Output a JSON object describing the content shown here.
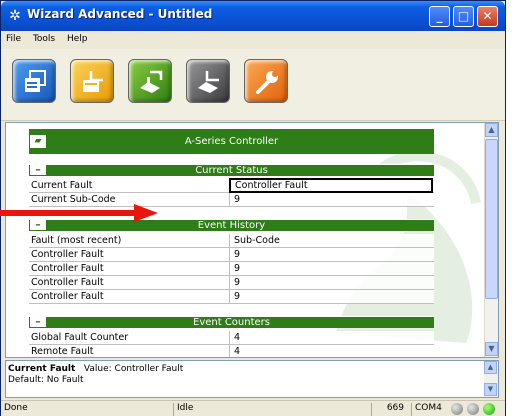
{
  "window": {
    "title": "Wizard Advanced - Untitled"
  },
  "menu": [
    "File",
    "Tools",
    "Help"
  ],
  "toolbar": [
    {
      "icon": "windows-doc-icon",
      "color": "#1e6fd0"
    },
    {
      "icon": "folder-window-icon",
      "color": "#f2b31a"
    },
    {
      "icon": "device-upload-icon",
      "color": "#4fa124"
    },
    {
      "icon": "device-download-icon",
      "color": "#57575a"
    },
    {
      "icon": "wrench-icon",
      "color": "#f07d1e"
    }
  ],
  "panel": {
    "title": "A-Series Controller",
    "sections": [
      {
        "title": "Current Status",
        "rows": [
          {
            "label": "Current Fault",
            "value": "Controller Fault"
          },
          {
            "label": "Current Sub-Code",
            "value": "9"
          }
        ]
      },
      {
        "title": "Event History",
        "rows": [
          {
            "label": "Fault (most recent)",
            "value": "Sub-Code"
          },
          {
            "label": "Controller Fault",
            "value": "9"
          },
          {
            "label": "Controller Fault",
            "value": "9"
          },
          {
            "label": "Controller Fault",
            "value": "9"
          },
          {
            "label": "Controller Fault",
            "value": "9"
          }
        ]
      },
      {
        "title": "Event Counters",
        "rows": [
          {
            "label": "Global Fault Counter",
            "value": "4"
          },
          {
            "label": "Remote Fault",
            "value": "4"
          }
        ]
      }
    ]
  },
  "description": {
    "name": "Current Fault",
    "value_text": "Value: Controller Fault",
    "default_text": "Default: No Fault"
  },
  "status": {
    "state": "Done",
    "mode": "Idle",
    "count": "669",
    "port": "COM4"
  },
  "colors": {
    "header_green": "#2e7d16",
    "arrow_red": "#e8160c"
  }
}
